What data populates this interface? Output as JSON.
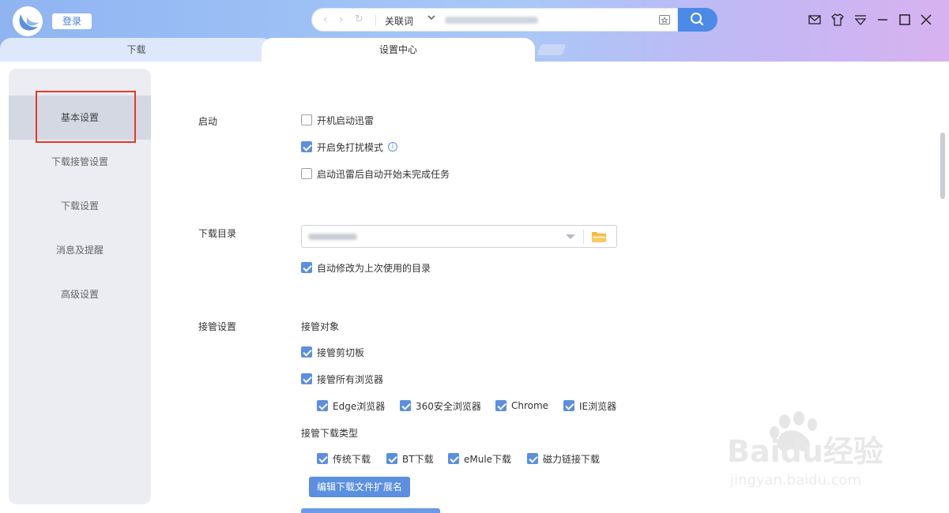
{
  "login_label": "登录",
  "address_bar": {
    "keyword_label": "关联词"
  },
  "tabs": [
    {
      "label": "下载"
    },
    {
      "label": "设置中心"
    }
  ],
  "sidebar": {
    "items": [
      {
        "label": "基本设置"
      },
      {
        "label": "下载接管设置"
      },
      {
        "label": "下载设置"
      },
      {
        "label": "消息及提醒"
      },
      {
        "label": "高级设置"
      }
    ]
  },
  "startup": {
    "label": "启动",
    "options": [
      {
        "label": "开机启动迅雷",
        "checked": false
      },
      {
        "label": "开启免打扰模式",
        "checked": true
      },
      {
        "label": "启动迅雷后自动开始未完成任务",
        "checked": false
      }
    ]
  },
  "download_dir": {
    "label": "下载目录",
    "auto_change_label": "自动修改为上次使用的目录"
  },
  "takeover": {
    "label": "接管设置",
    "target_label": "接管对象",
    "clipboard_label": "接管剪切板",
    "all_browsers_label": "接管所有浏览器",
    "browsers": [
      {
        "label": "Edge浏览器"
      },
      {
        "label": "360安全浏览器"
      },
      {
        "label": "Chrome"
      },
      {
        "label": "IE浏览器"
      }
    ],
    "types_label": "接管下载类型",
    "types": [
      {
        "label": "传统下载"
      },
      {
        "label": "BT下载"
      },
      {
        "label": "eMule下载"
      },
      {
        "label": "磁力链接下载"
      }
    ],
    "edit_ext_button": "编辑下载文件扩展名"
  },
  "watermark": {
    "brand": "Baidu经验",
    "url": "jingyan.baidu.com"
  },
  "colors": {
    "accent": "#5b8fe0",
    "highlight_box": "#e53a2a"
  }
}
